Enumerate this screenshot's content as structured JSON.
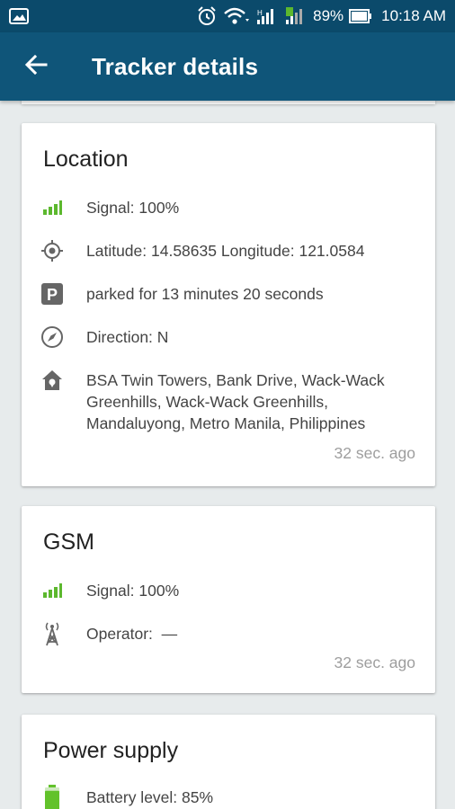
{
  "status_bar": {
    "battery_percent": "89%",
    "time": "10:18 AM"
  },
  "appbar": {
    "title": "Tracker details"
  },
  "colors": {
    "primary": "#0f5579",
    "status_bar": "#0b4a6b",
    "signal_green": "#5cb82e",
    "battery_green": "#62c22b"
  },
  "location": {
    "title": "Location",
    "signal": "Signal: 100%",
    "coords": "Latitude: 14.58635 Longitude: 121.0584",
    "parked": "parked for 13 minutes 20 seconds",
    "direction": "Direction: N",
    "address": "BSA Twin Towers, Bank Drive, Wack-Wack Greenhills, Wack-Wack Greenhills, Mandaluyong, Metro Manila, Philippines",
    "timestamp": "32 sec. ago"
  },
  "gsm": {
    "title": "GSM",
    "signal": "Signal: 100%",
    "operator": "Operator:  —",
    "timestamp": "32 sec. ago"
  },
  "power": {
    "title": "Power supply",
    "battery": "Battery level: 85%",
    "battery_level": 0.85
  },
  "icons": [
    "gallery-icon",
    "alarm-icon",
    "wifi-icon",
    "cell-signal-icon",
    "battery-icon",
    "back-arrow-icon",
    "signal-bars-icon",
    "gps-target-icon",
    "parking-icon",
    "compass-icon",
    "home-pin-icon",
    "cell-tower-icon",
    "battery-level-icon"
  ]
}
